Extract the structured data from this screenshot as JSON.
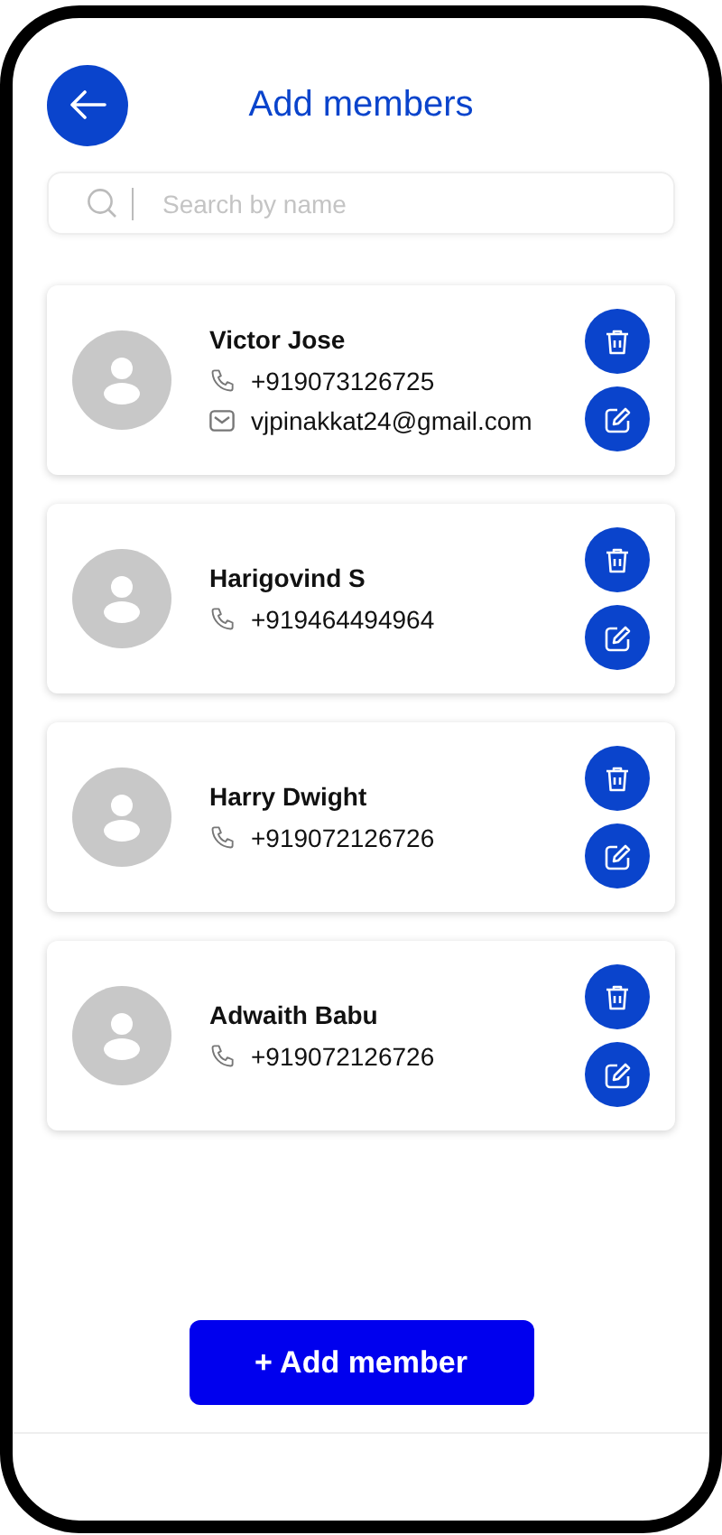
{
  "header": {
    "title": "Add members"
  },
  "search": {
    "placeholder": "Search by name"
  },
  "members": [
    {
      "name": "Victor Jose",
      "contacts": [
        {
          "kind": "phone",
          "text": "+919073126725"
        },
        {
          "kind": "email",
          "text": "vjpinakkat24@gmail.com"
        }
      ]
    },
    {
      "name": "Harigovind S",
      "contacts": [
        {
          "kind": "phone",
          "text": "+919464494964"
        }
      ]
    },
    {
      "name": "Harry Dwight",
      "contacts": [
        {
          "kind": "phone",
          "text": "+919072126726"
        }
      ]
    },
    {
      "name": "Adwaith Babu",
      "contacts": [
        {
          "kind": "phone",
          "text": "+919072126726"
        }
      ]
    }
  ],
  "add_button": {
    "label": "+ Add member"
  }
}
